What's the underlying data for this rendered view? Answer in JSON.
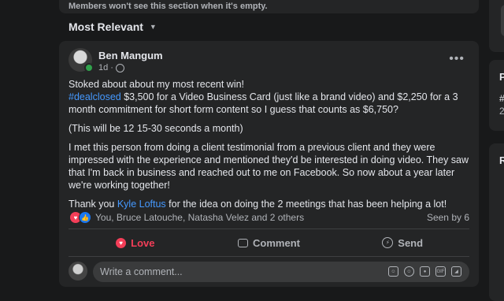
{
  "group_notice": {
    "text": "Members won't see this section when it's empty."
  },
  "sort": {
    "label": "Most Relevant"
  },
  "post": {
    "author": "Ben Mangum",
    "time": "1d",
    "dot": "·",
    "more_label": "•••",
    "paragraphs": {
      "p1": "Stoked about about my most recent win!",
      "hashtag": "#dealclosed",
      "p2_rest": " $3,500 for a Video Business Card (just like a brand video) and $2,250 for a 3 month commitment for short form content so I guess that counts as $6,750?",
      "p3": "(This will be 12 15-30 seconds a month)",
      "p4": "I met this person from doing a client testimonial from a previous client and they were impressed with the experience and mentioned they'd be interested in doing video. They saw that I'm back in business and reached out to me on Facebook. So now about a year later we're working together!",
      "p5_pre": "Thank you ",
      "mention": "Kyle Loftus",
      "p5_post": " for the idea on doing the 2 meetings that has been helping a lot!"
    },
    "reactions": {
      "names": "You, Bruce Latouche, Natasha Velez and 2 others",
      "seen": "Seen by 6"
    },
    "actions": {
      "love": "Love",
      "comment": "Comment",
      "send": "Send"
    },
    "comment_placeholder": "Write a comment...",
    "colors": {
      "love": "#f33e58",
      "link": "#4599ff",
      "like": "#1877f2"
    }
  },
  "sidebar": {
    "mid_title": "P",
    "mid_line1": "#",
    "mid_line2": "2",
    "bot_title": "R"
  }
}
